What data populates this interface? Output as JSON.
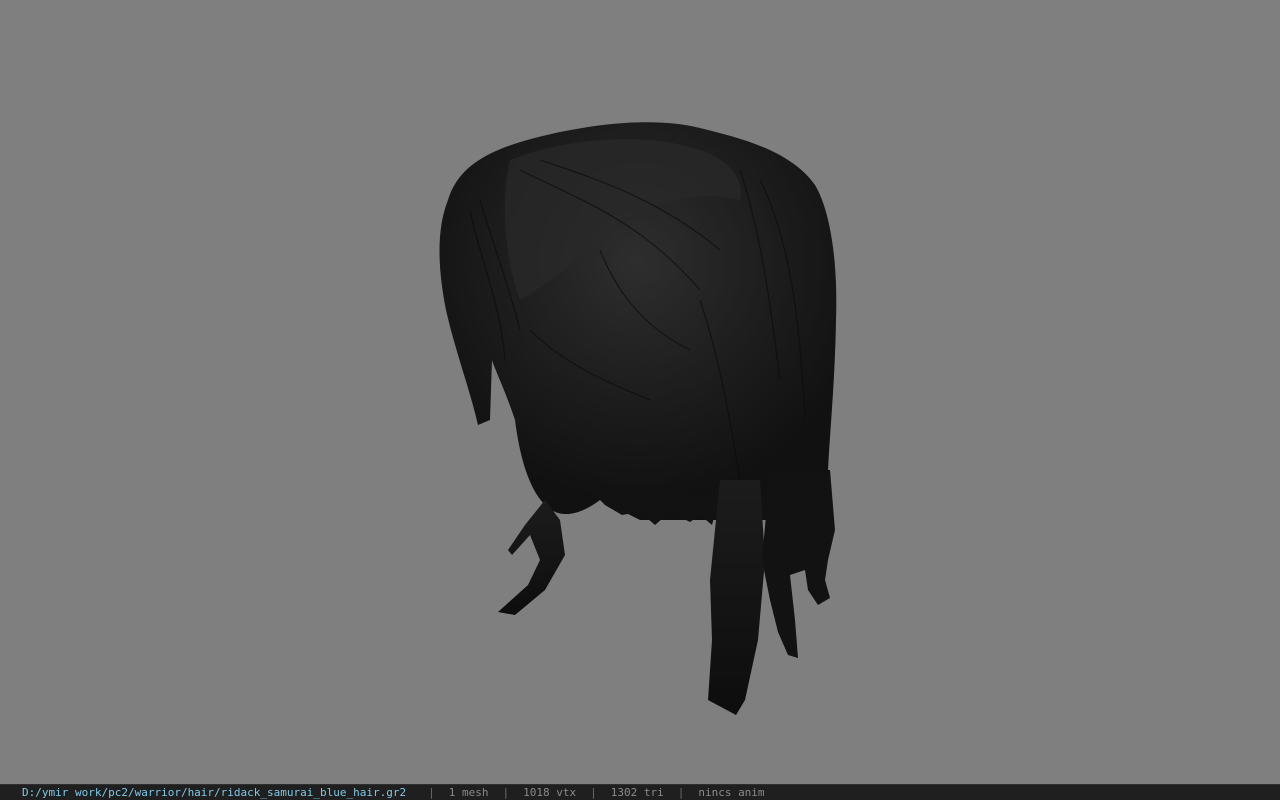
{
  "status_bar": {
    "file_path": "D:/ymir work/pc2/warrior/hair/ridack_samurai_blue_hair.gr2",
    "mesh_count": "1 mesh",
    "vertex_count": "1018 vtx",
    "triangle_count": "1302 tri",
    "animation": "nincs anim"
  },
  "colors": {
    "viewport_background": "#7f7f7f",
    "status_bar_background": "#1f1f1f",
    "path_text": "#7fc8e8",
    "stat_text": "#8a8a8a",
    "hair_base": "#1a1a1a",
    "hair_highlight": "#2b2b2b"
  }
}
